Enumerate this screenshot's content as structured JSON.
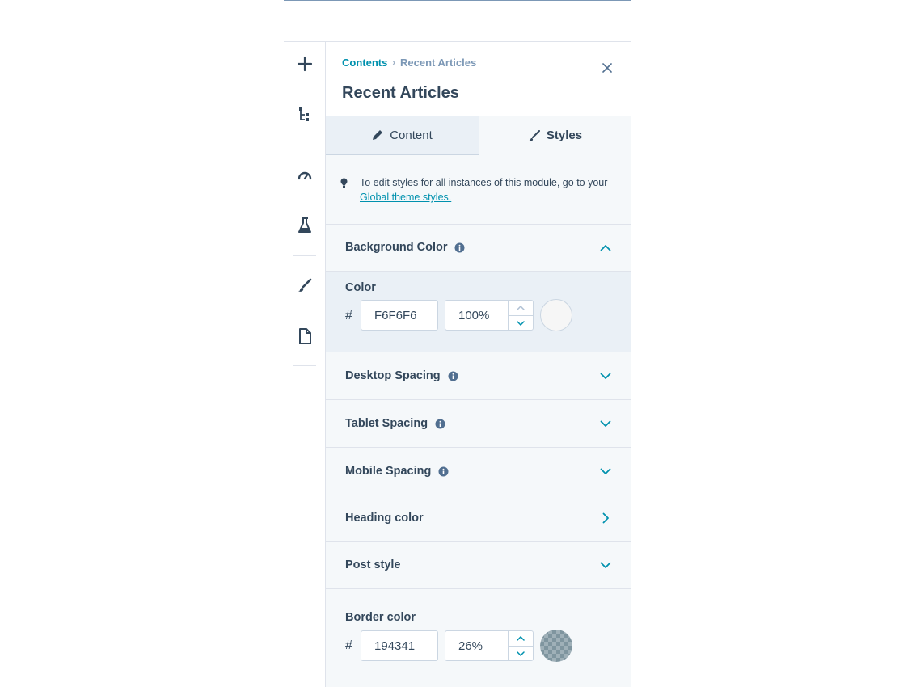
{
  "breadcrumb": {
    "parent": "Contents",
    "separator": "›",
    "current": "Recent Articles"
  },
  "panel": {
    "title": "Recent Articles"
  },
  "tabs": [
    {
      "label": "Content",
      "icon": "pencil-icon",
      "selected": false
    },
    {
      "label": "Styles",
      "icon": "brush-icon",
      "selected": true
    }
  ],
  "notice": {
    "text": "To edit styles for all instances of this module, go to your ",
    "link": "Global theme styles."
  },
  "rail": {
    "icons": [
      "add-icon",
      "tree-icon",
      "gauge-icon",
      "flask-icon",
      "brush-icon",
      "document-icon"
    ]
  },
  "sections": {
    "background_color": {
      "title": "Background Color",
      "expanded": true
    },
    "desktop_spacing": {
      "title": "Desktop Spacing",
      "expanded": false
    },
    "tablet_spacing": {
      "title": "Tablet Spacing",
      "expanded": false
    },
    "mobile_spacing": {
      "title": "Mobile Spacing",
      "expanded": false
    },
    "heading_color": {
      "title": "Heading color",
      "expanded": false
    },
    "post_style": {
      "title": "Post style",
      "expanded": false
    }
  },
  "background_color_field": {
    "label": "Color",
    "hash": "#",
    "hex": "F6F6F6",
    "opacity": "100%",
    "swatch": "#f6f6f6"
  },
  "border_color_field": {
    "label": "Border color",
    "hash": "#",
    "hex": "194341",
    "opacity": "26%",
    "swatch": "#194341"
  },
  "colors": {
    "accent": "#0091ae",
    "text": "#33475b",
    "panel_bg": "#f5f8fa",
    "border": "#dfe3eb"
  }
}
